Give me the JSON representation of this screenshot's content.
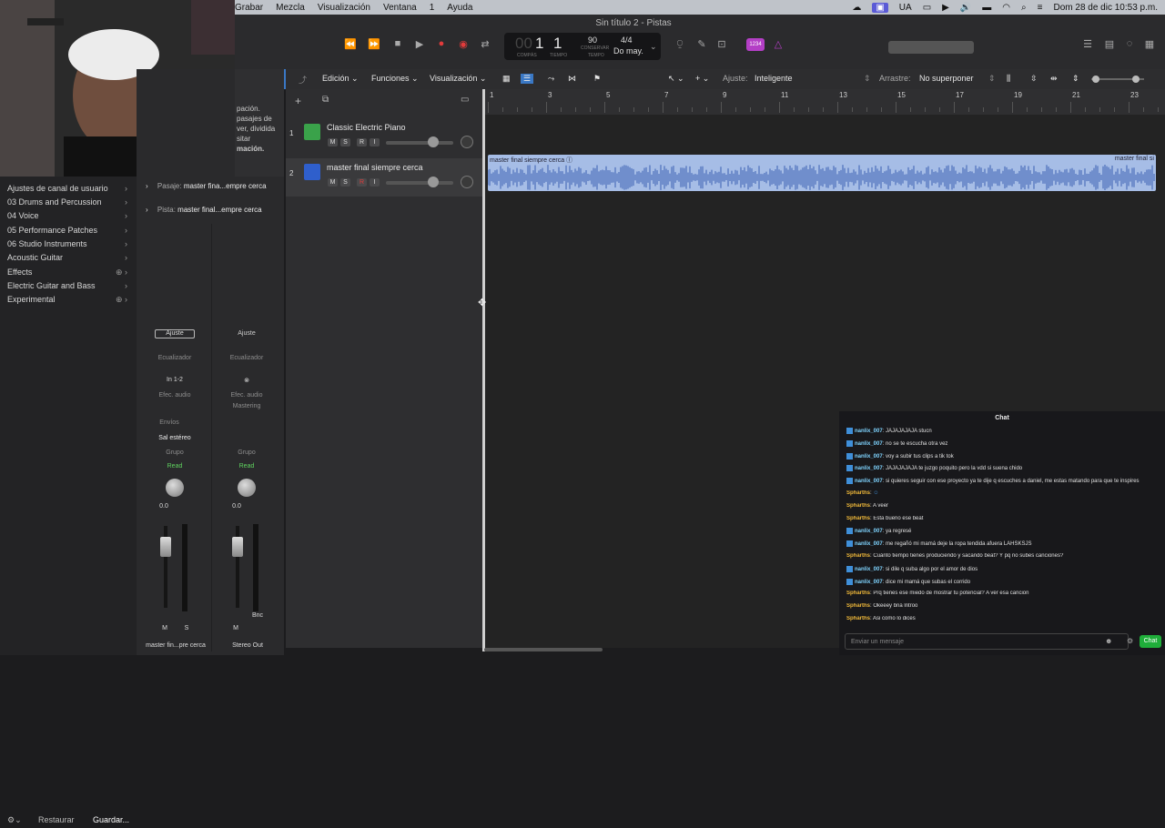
{
  "menubar": {
    "items": [
      "Grabar",
      "Mezcla",
      "Visualización",
      "Ventana",
      "1",
      "Ayuda"
    ],
    "input_source": "UA",
    "datetime": "Dom 28 de dic  10:53 p.m."
  },
  "window": {
    "title": "Sin título 2 - Pistas"
  },
  "lcd": {
    "bar_dim": "00",
    "bar": "1",
    "beat": "1",
    "bar_label": "COMPÁS",
    "beat_label": "TIEMPO",
    "tempo": "90",
    "tempo_label": "CONSERVAR",
    "tempo_sub": "TEMPO",
    "signature": "4/4",
    "key": "Do may."
  },
  "count_in": "1234",
  "library": {
    "items": [
      {
        "label": "Ajustes de canal de usuario"
      },
      {
        "label": "03 Drums and Percussion"
      },
      {
        "label": "04 Voice"
      },
      {
        "label": "05 Performance Patches"
      },
      {
        "label": "06 Studio Instruments"
      },
      {
        "label": "Acoustic Guitar"
      },
      {
        "label": "Effects"
      },
      {
        "label": "Electric Guitar and Bass"
      },
      {
        "label": "Experimental"
      }
    ],
    "restore_label": "Restaurar",
    "save_label": "Guardar..."
  },
  "inspector": {
    "tooltip_lines": [
      "pación.",
      "pasajes de",
      "ver, dividida",
      "sitar",
      "mación."
    ],
    "region_prefix": "Pasaje:",
    "region_name": "master fina...empre cerca",
    "track_prefix": "Pista:",
    "track_name": "master final...empre cerca",
    "strip1": {
      "setting": "Ajuste",
      "eq": "Ecualizador",
      "input": "In 1-2",
      "fx": "Efec. audio",
      "sends": "Envíos",
      "output": "Sal estéreo",
      "group": "Grupo",
      "automation": "Read",
      "volume": "0.0",
      "mute": "M",
      "solo": "S",
      "name": "master fin...pre cerca"
    },
    "strip2": {
      "setting": "Ajuste",
      "eq": "Ecualizador",
      "fx": "Efec. audio",
      "fx_plugin": "Mastering",
      "group": "Grupo",
      "automation": "Read",
      "volume": "0.0",
      "mute": "M",
      "bounce": "Bnc",
      "name": "Stereo Out"
    }
  },
  "tracks_toolbar": {
    "edit": "Edición",
    "functions": "Funciones",
    "view": "Visualización",
    "snap_label": "Ajuste:",
    "snap_value": "Inteligente",
    "drag_label": "Arrastre:",
    "drag_value": "No superponer"
  },
  "ruler": {
    "numbers": [
      "1",
      "3",
      "5",
      "7",
      "9",
      "11",
      "13",
      "15",
      "17",
      "19",
      "21",
      "23"
    ]
  },
  "tracks": [
    {
      "number": "1",
      "name": "Classic Electric Piano",
      "m": "M",
      "s": "S",
      "r": "R",
      "i": "I"
    },
    {
      "number": "2",
      "name": "master final siempre cerca",
      "m": "M",
      "s": "S",
      "r": "R",
      "i": "I"
    }
  ],
  "region": {
    "name": "master final siempre cerca",
    "name_end": "master final si"
  },
  "chat": {
    "title": "Chat",
    "messages": [
      {
        "user": "nanlix_007",
        "type": "u1",
        "text": "JAJAJAJAJA stucn"
      },
      {
        "user": "nanlix_007",
        "type": "u1",
        "text": "no se te escucha otra vez"
      },
      {
        "user": "nanlix_007",
        "type": "u1",
        "text": "voy a subir tus clips a tik tok"
      },
      {
        "user": "nanlix_007",
        "type": "u1",
        "text": "JAJAJAJAJA te juzgo poquito pero la vdd si suena chido"
      },
      {
        "user": "nanlix_007",
        "type": "u1",
        "text": "si quieres seguir con ese proyecto ya te dije q escuches a daniel, me estas matando para que te inspires"
      },
      {
        "user": "Spharths",
        "type": "u2",
        "text": ""
      },
      {
        "user": "Spharths",
        "type": "u2",
        "text": "A veer"
      },
      {
        "user": "Spharths",
        "type": "u2",
        "text": "Esta bueno ese beat"
      },
      {
        "user": "nanlix_007",
        "type": "u1",
        "text": "ya regresé"
      },
      {
        "user": "nanlix_007",
        "type": "u1",
        "text": "me regañó mi mamá deje la ropa tendida afuera LAHSKSJS"
      },
      {
        "user": "Spharths",
        "type": "u2",
        "text": "Cuánto tiempo tienes produciendo y sacando beat? Y pq no subes canciones?"
      },
      {
        "user": "nanlix_007",
        "type": "u1",
        "text": "si dile q suba algo por el amor de dios"
      },
      {
        "user": "nanlix_007",
        "type": "u1",
        "text": "dice mi mamá que subas el corrido"
      },
      {
        "user": "Spharths",
        "type": "u2",
        "text": "Prq tienes ese miedo de mostrar tu potencial? A ver esa cancion"
      },
      {
        "user": "Spharths",
        "type": "u2",
        "text": "Okeeey bná lntroo"
      },
      {
        "user": "Spharths",
        "type": "u2",
        "text": "Asi como lo dices"
      }
    ],
    "input_placeholder": "Enviar un mensaje",
    "send_label": "Chat"
  }
}
